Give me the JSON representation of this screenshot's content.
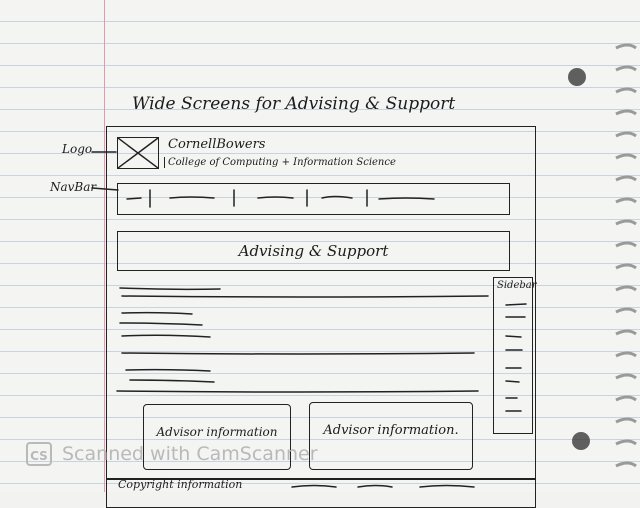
{
  "sketch": {
    "title": "Wide Screens for Advising & Support",
    "brand": {
      "name": "CornellBowers",
      "subtitle": "College of Computing + Information Science"
    },
    "banner": "Advising & Support",
    "sidebar_label": "Sidebar",
    "cards": [
      "Advisor information",
      "Advisor information."
    ],
    "footer": "Copyright information"
  },
  "annotations": {
    "logo": "Logo",
    "navbar": "NavBar"
  },
  "watermark": {
    "icon_text": "CS",
    "text": "Scanned with CamScanner"
  },
  "colors": {
    "paper": "#f4f4f2",
    "rule_line": "#c9d3e0",
    "margin_line": "#e29aab",
    "ink": "#1c1c1c",
    "watermark": "#b9b9b9"
  }
}
